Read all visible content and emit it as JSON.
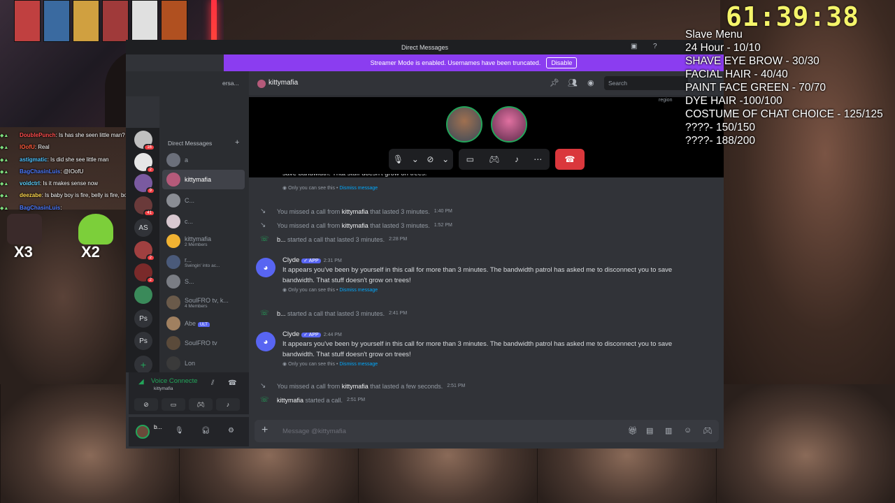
{
  "overlay": {
    "timer": "61:39:38",
    "menu": [
      "Slave Menu",
      "24 Hour - 10/10",
      "SHAVE EYE BROW - 30/30",
      "FACIAL HAIR - 40/40",
      "PAINT FACE GREEN - 70/70",
      "DYE HAIR -100/100",
      "COSTUME OF CHAT CHOICE - 125/125",
      "????- 150/150",
      "????- 188/200"
    ],
    "emotes": [
      "X3",
      "X2"
    ]
  },
  "stream_chat": [
    {
      "user": "DoublePunch",
      "text": ": Is has she seen little man?",
      "color": "#ff4d4d"
    },
    {
      "user": "lOofU",
      "text": ": Real",
      "color": "#ff5a3a"
    },
    {
      "user": "astigmatic",
      "text": ": Is did she see little man",
      "color": "#4dc3ff"
    },
    {
      "user": "BagChasinLuis",
      "text": ": @lOofU",
      "color": "#4d7bff"
    },
    {
      "user": "voidctrl",
      "text": ": Is it makes sense now",
      "color": "#5bd1ff"
    },
    {
      "user": "deezabe",
      "text": ": Is baby boy is fire, belly is fire, boyz n da hood is fire",
      "color": "#ffd84d"
    },
    {
      "user": "BagChasinLuis",
      "text": ":",
      "color": "#4d7bff"
    }
  ],
  "discord": {
    "window_title": "Direct Messages",
    "streamer_banner": "Streamer Mode is enabled. Usernames have been truncated.",
    "dismiss_label": "Disable",
    "left_tab_fragment": "ersa...",
    "direct_messages_header": "Direct Messages",
    "servers": [
      {
        "label": "",
        "badge": "16"
      },
      {
        "label": "",
        "badge": "2"
      },
      {
        "label": "",
        "badge": "9"
      },
      {
        "label": "",
        "badge": "41"
      },
      {
        "label": "AS",
        "badge": ""
      },
      {
        "label": "",
        "badge": "2"
      },
      {
        "label": "",
        "badge": "2"
      },
      {
        "label": "",
        "badge": ""
      },
      {
        "label": "Ps",
        "badge": ""
      },
      {
        "label": "Ps",
        "badge": ""
      }
    ],
    "dm_list": [
      {
        "name": "a",
        "sub": "",
        "color": "#6b6f7a"
      },
      {
        "name": "kittymafia",
        "sub": "",
        "color": "#b55a7a",
        "active": true
      },
      {
        "name": "C...",
        "sub": "",
        "color": "#8a8d94"
      },
      {
        "name": "c...",
        "sub": "",
        "color": "#d8c8d0"
      },
      {
        "name": "kittymafia",
        "sub": "2 Members",
        "color": "#f0b232"
      },
      {
        "name": "r...",
        "sub": "Swingin' into ac...",
        "color": "#4a5a7a"
      },
      {
        "name": "S...",
        "sub": "",
        "color": "#7a7d84"
      },
      {
        "name": "SoulFRO tv, k...",
        "sub": "4 Members",
        "color": "#6a5a4a"
      },
      {
        "name": "Abe",
        "sub": "",
        "color": "#a08060",
        "badge": "ULT"
      },
      {
        "name": "SoulFRO tv",
        "sub": "",
        "color": "#5a4a3a"
      },
      {
        "name": "Lon",
        "sub": "",
        "color": "#3a3a3a"
      }
    ],
    "voice": {
      "status": "Voice Connecte",
      "channel": "kittymafia"
    },
    "user": {
      "name": "b..."
    },
    "channel_name": "kittymafia",
    "search_placeholder": "Search",
    "region_label": "region",
    "messages": [
      {
        "type": "truncated",
        "text": "save bandwidth. That stuff doesn't grow on trees!"
      },
      {
        "type": "only_you",
        "text": "Only you can see this",
        "link": "Dismiss message"
      },
      {
        "type": "missed",
        "pre": "You missed a call from ",
        "who": "kittymafia",
        "post": " that lasted 3 minutes.",
        "time": "1:40 PM"
      },
      {
        "type": "missed",
        "pre": "You missed a call from ",
        "who": "kittymafia",
        "post": " that lasted 3 minutes.",
        "time": "1:52 PM"
      },
      {
        "type": "started",
        "who": "b...",
        "post": " started a call that lasted 3 minutes.",
        "time": "2:28 PM"
      },
      {
        "type": "bot",
        "name": "Clyde",
        "tag": "✓ APP",
        "time": "2:31 PM",
        "text": "It appears you've been by yourself in this call for more than 3 minutes. The bandwidth patrol has asked me to disconnect you to save bandwidth. That stuff doesn't grow on trees!",
        "only": "Only you can see this",
        "link": "Dismiss message"
      },
      {
        "type": "started",
        "who": "b...",
        "post": " started a call that lasted 3 minutes.",
        "time": "2:41 PM"
      },
      {
        "type": "bot",
        "name": "Clyde",
        "tag": "✓ APP",
        "time": "2:44 PM",
        "text": "It appears you've been by yourself in this call for more than 3 minutes. The bandwidth patrol has asked me to disconnect you to save bandwidth. That stuff doesn't grow on trees!",
        "only": "Only you can see this",
        "link": "Dismiss message"
      },
      {
        "type": "missed",
        "pre": "You missed a call from ",
        "who": "kittymafia",
        "post": " that lasted a few seconds.",
        "time": "2:51 PM"
      },
      {
        "type": "started",
        "who": "kittymafia",
        "post": " started a call.",
        "time": "2:51 PM"
      }
    ],
    "composer_placeholder": "Message @kittymafia"
  }
}
